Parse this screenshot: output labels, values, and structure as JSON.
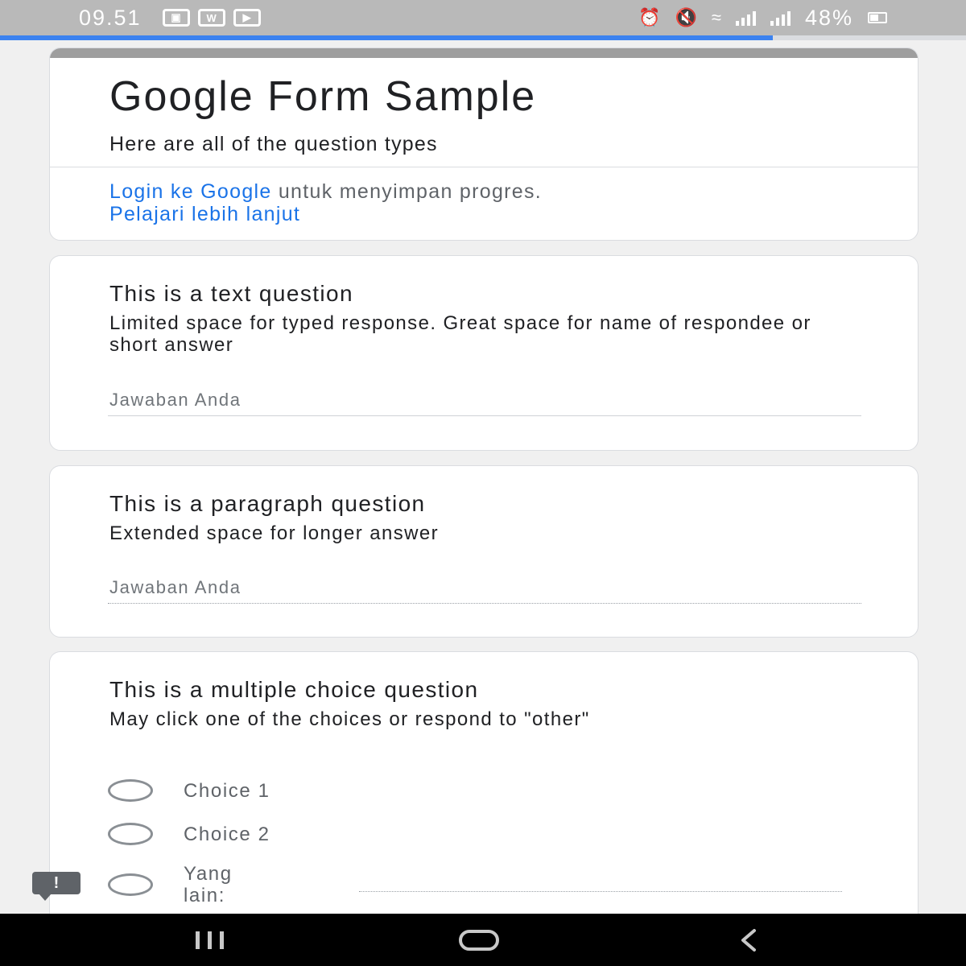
{
  "status_bar": {
    "time": "09.51",
    "left_icons": [
      "gallery-icon",
      "w-app-icon",
      "video-icon"
    ],
    "right_icons": [
      "alarm-icon",
      "mute-icon",
      "wifi-icon",
      "signal-icon",
      "signal-icon"
    ],
    "battery": "48%"
  },
  "progress": {
    "fraction": 0.8,
    "color": "#3b82f0"
  },
  "form": {
    "title": "Google Form Sample",
    "description": "Here are all of the question types",
    "signin_link": "Login ke Google",
    "signin_text": " untuk menyimpan progres.",
    "learn_more": "Pelajari lebih lanjut"
  },
  "questions": [
    {
      "title": "This is a text question",
      "description": "Limited space for typed response. Great space for name of respondee or short answer",
      "placeholder": "Jawaban Anda"
    },
    {
      "title": "This is a paragraph question",
      "description": "Extended space for longer answer",
      "placeholder": "Jawaban Anda"
    },
    {
      "title": "This is a multiple choice question",
      "description": "May click one of the choices or respond to \"other\"",
      "choices": [
        "Choice 1",
        "Choice 2"
      ],
      "other_label": "Yang lain:"
    }
  ],
  "colors": {
    "link": "#1a73e8",
    "header_accent": "#9e9e9e",
    "background": "#f0f0f0"
  }
}
